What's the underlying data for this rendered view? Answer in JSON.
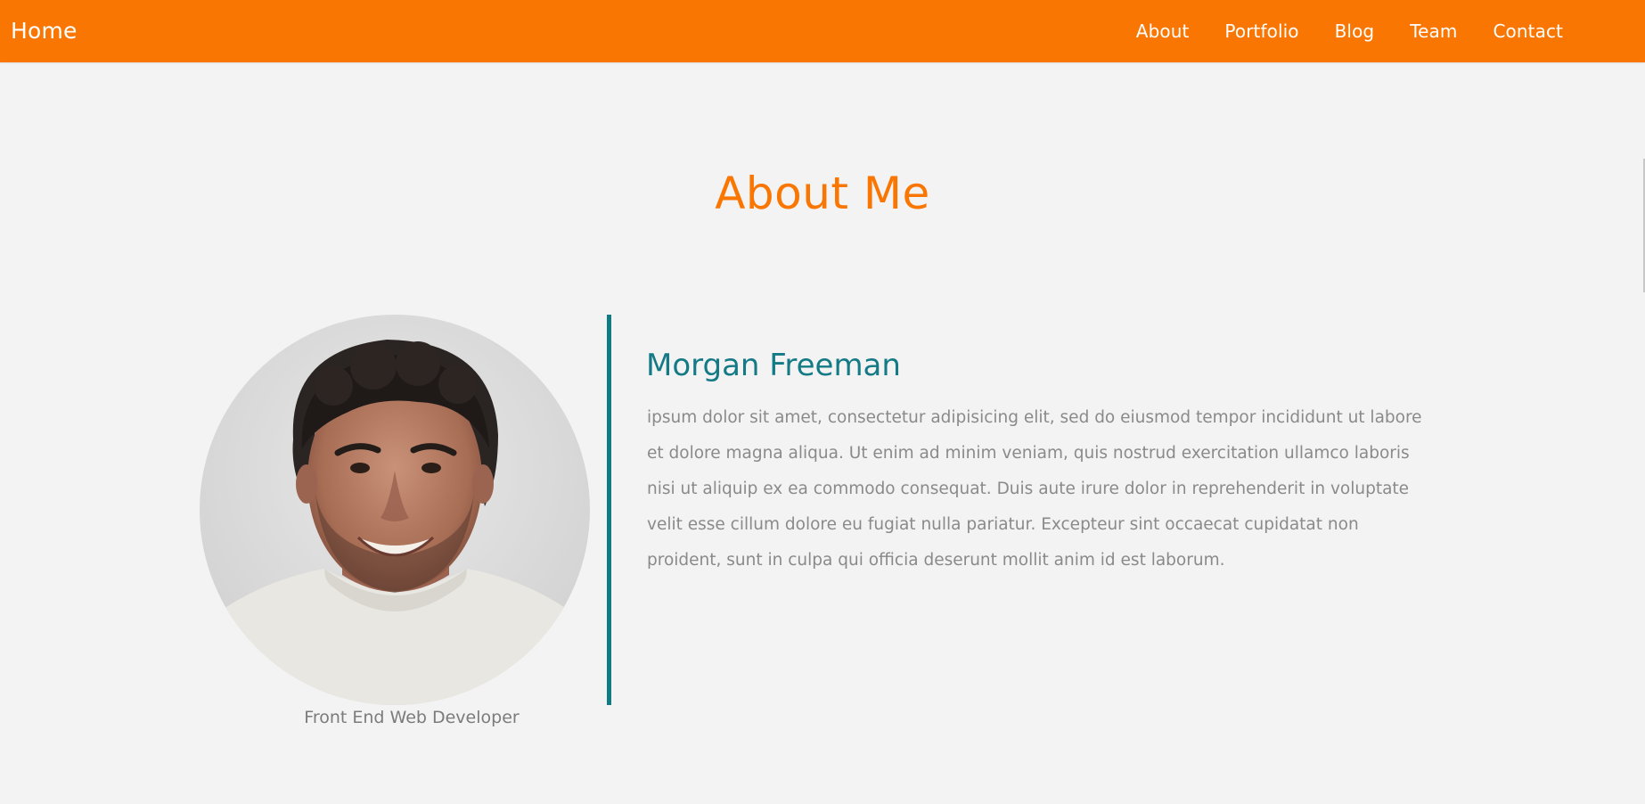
{
  "nav": {
    "brand": "Home",
    "links": [
      "About",
      "Portfolio",
      "Blog",
      "Team",
      "Contact"
    ]
  },
  "about": {
    "title": "About Me",
    "name": "Morgan Freeman",
    "role": "Front End Web Developer",
    "bio": "ipsum dolor sit amet, consectetur adipisicing elit, sed do eiusmod tempor incididunt ut labore et dolore magna aliqua. Ut enim ad minim veniam, quis nostrud exercitation ullamco laboris nisi ut aliquip ex ea commodo consequat. Duis aute irure dolor in reprehenderit in voluptate velit esse cillum dolore eu fugiat nulla pariatur. Excepteur sint occaecat cupidatat non proident, sunt in culpa qui officia deserunt mollit anim id est laborum."
  },
  "colors": {
    "nav_bg": "#fa7603",
    "accent_orange": "#fa7603",
    "accent_teal": "#117b85",
    "page_bg": "#f3f3f3",
    "body_text": "#8a8a8a"
  }
}
